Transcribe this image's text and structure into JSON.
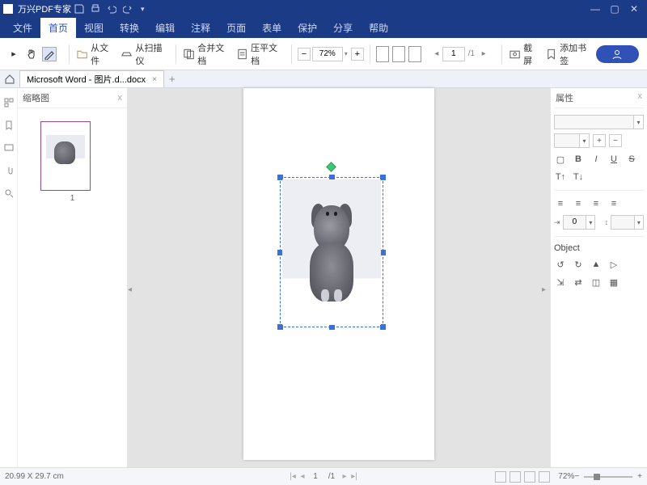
{
  "app_title": "万兴PDF专家",
  "menus": [
    "文件",
    "首页",
    "视图",
    "转换",
    "编辑",
    "注释",
    "页面",
    "表单",
    "保护",
    "分享",
    "帮助"
  ],
  "active_menu": 1,
  "ribbon": {
    "from_file": "从文件",
    "from_scanner": "从扫描仪",
    "merge": "合并文档",
    "compress": "压平文档",
    "zoom": "72%",
    "page_current": "1",
    "page_total": "/1",
    "screenshot": "截屏",
    "add_bookmark": "添加书签"
  },
  "tab": {
    "name": "Microsoft Word - 图片.d...docx"
  },
  "thumb_panel": {
    "title": "缩略图",
    "page_num": "1"
  },
  "right_panel": {
    "title": "属性",
    "font_placeholder": "",
    "size_placeholder": "",
    "indent_val": "0",
    "object_label": "Object"
  },
  "status": {
    "dims": "20.99 X 29.7 cm",
    "page": "1",
    "page_total": "/1",
    "zoom": "72%"
  }
}
